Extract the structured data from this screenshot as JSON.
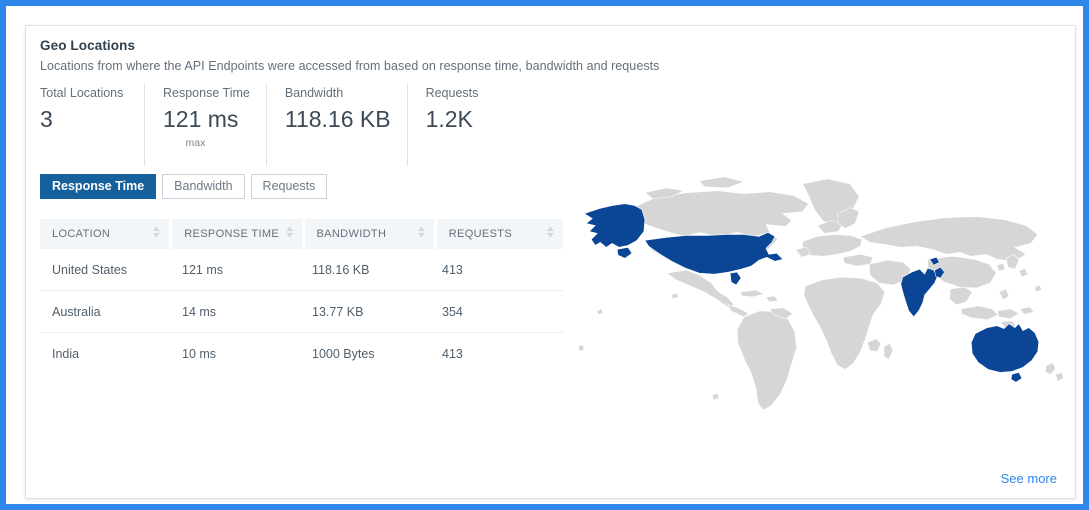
{
  "card": {
    "title": "Geo Locations",
    "subtitle": "Locations from where the API Endpoints were accessed from based on response time, bandwidth and requests",
    "see_more_label": "See more"
  },
  "metrics": [
    {
      "label": "Total Locations",
      "value": "3",
      "sub": ""
    },
    {
      "label": "Response Time",
      "value": "121 ms",
      "sub": "max"
    },
    {
      "label": "Bandwidth",
      "value": "118.16 KB",
      "sub": ""
    },
    {
      "label": "Requests",
      "value": "1.2K",
      "sub": ""
    }
  ],
  "tabs": [
    {
      "label": "Response Time",
      "active": true
    },
    {
      "label": "Bandwidth",
      "active": false
    },
    {
      "label": "Requests",
      "active": false
    }
  ],
  "table": {
    "columns": [
      "LOCATION",
      "RESPONSE TIME(...",
      "BANDWIDTH",
      "REQUESTS"
    ],
    "rows": [
      {
        "location": "United States",
        "response_time": "121 ms",
        "bandwidth": "118.16 KB",
        "requests": "413"
      },
      {
        "location": "Australia",
        "response_time": "14 ms",
        "bandwidth": "13.77 KB",
        "requests": "354"
      },
      {
        "location": "India",
        "response_time": "10 ms",
        "bandwidth": "1000 Bytes",
        "requests": "413"
      }
    ]
  },
  "map": {
    "highlighted_countries": [
      "United States",
      "India",
      "Australia"
    ],
    "highlight_color": "#0a4596",
    "base_color": "#d6d6d6"
  },
  "colors": {
    "frame_blue": "#2f86eb",
    "active_tab": "#16609c",
    "link": "#2f86eb"
  }
}
